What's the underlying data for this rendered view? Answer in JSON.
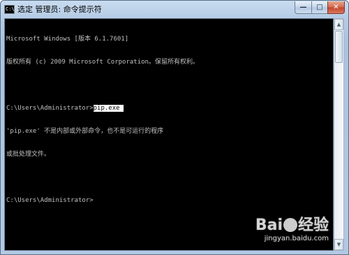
{
  "window": {
    "title": "选定 管理员: 命令提示符",
    "app_icon_glyph": "C:\\",
    "buttons": {
      "minimize": "—",
      "maximize": "□",
      "close": "✕"
    }
  },
  "console": {
    "lines": [
      "Microsoft Windows [版本 6.1.7601]",
      "版权所有 (c) 2009 Microsoft Corporation。保留所有权利。",
      "",
      "C:\\Users\\Administrator>",
      "'pip.exe' 不是内部或外部命令，也不是可运行的程序",
      "或批处理文件。",
      "",
      "C:\\Users\\Administrator>"
    ],
    "selected_text": "pip.exe ",
    "text_color": "#c0c0c0",
    "background_color": "#000000"
  },
  "scrollbar": {
    "up_arrow": "▲",
    "down_arrow": "▼"
  },
  "watermark": {
    "logo_prefix": "Bai",
    "logo_suffix": "经验",
    "url": "jingyan.baidu.com"
  }
}
